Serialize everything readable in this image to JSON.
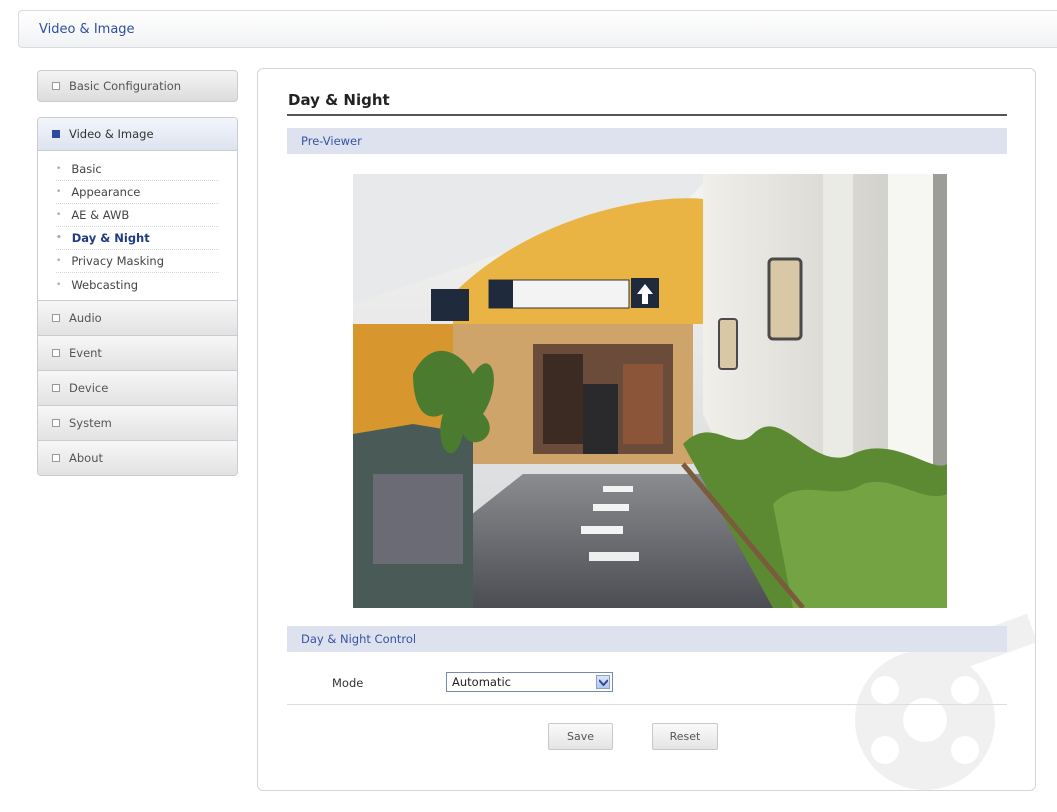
{
  "header": {
    "title": "Video & Image"
  },
  "sidebar": {
    "basic_config": "Basic Configuration",
    "active_group": "Video & Image",
    "sub_items": [
      "Basic",
      "Appearance",
      "AE & AWB",
      "Day & Night",
      "Privacy Masking",
      "Webcasting"
    ],
    "current_sub_item": "Day & Night",
    "other_groups": [
      "Audio",
      "Event",
      "Device",
      "System",
      "About"
    ]
  },
  "main": {
    "title": "Day & Night",
    "preview_section": "Pre-Viewer",
    "control_section": "Day & Night Control",
    "mode_label": "Mode",
    "mode_value": "Automatic",
    "save_label": "Save",
    "reset_label": "Reset"
  },
  "colors": {
    "accent": "#2f4fa0",
    "section_bg": "#dde2ee",
    "active_subitem": "#1f3b86"
  }
}
